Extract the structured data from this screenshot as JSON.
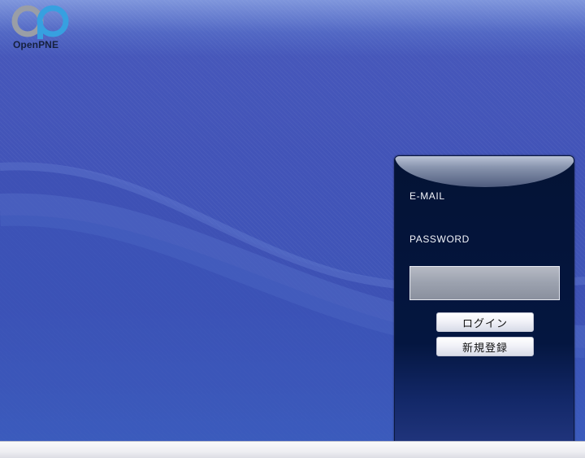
{
  "brand": {
    "logo_text": "OpenPNE"
  },
  "login": {
    "email_label": "E-MAIL",
    "password_label": "PASSWORD",
    "password_value": "",
    "login_button": "ログイン",
    "register_button": "新規登録"
  },
  "colors": {
    "background": "#4254b8",
    "panel": "#041640",
    "logo_blue": "#3aa4e0",
    "logo_grey": "#9fa2a8"
  }
}
